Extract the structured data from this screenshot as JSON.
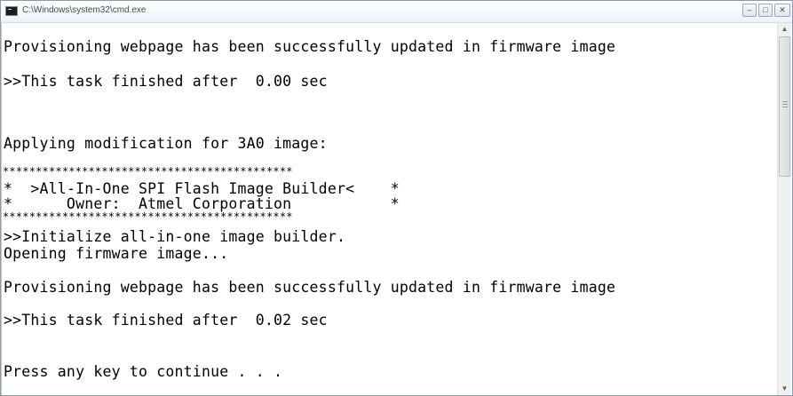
{
  "window": {
    "title": "C:\\Windows\\system32\\cmd.exe",
    "minimize_glyph": "–",
    "maximize_glyph": "□",
    "close_glyph": "✕"
  },
  "console": {
    "lines": [
      "Provisioning webpage has been successfully updated in firmware image",
      ">>This task finished after  0.00 sec",
      "Applying modification for 3A0 image:",
      "*  >All-In-One SPI Flash Image Builder<    *",
      "*      Owner:  Atmel Corporation           *",
      ">>Initialize all-in-one image builder.",
      "Opening firmware image...",
      "Provisioning webpage has been successfully updated in firmware image",
      ">>This task finished after  0.02 sec",
      "Press any key to continue . . ."
    ],
    "star_rule": "********************************************"
  },
  "scrollbar": {
    "up_glyph": "▲",
    "down_glyph": "▼"
  }
}
